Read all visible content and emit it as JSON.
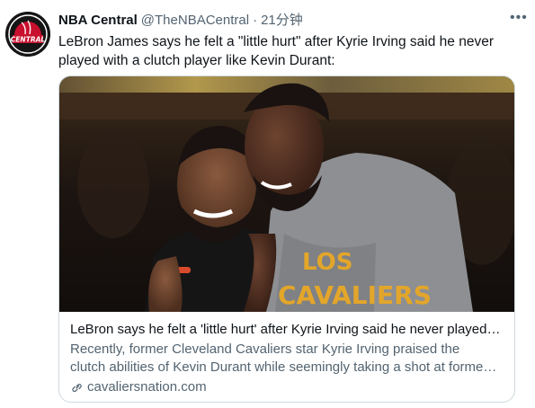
{
  "author": {
    "display_name": "NBA Central",
    "handle": "@TheNBACentral",
    "separator": "·",
    "time": "21分钟",
    "avatar_icon": "nba-central-logo",
    "avatar_text": "CENTRAL"
  },
  "more_icon": "ellipsis-icon",
  "tweet": {
    "text": "LeBron James says he felt a \"little hurt\" after Kyrie Irving said he never played with a clutch player like Kevin Durant:"
  },
  "card": {
    "image_desc": "photo",
    "image_text": [
      "LOS",
      "CAVALIERS"
    ],
    "title": "LeBron says he felt a 'little hurt' after Kyrie Irving said he never played…",
    "description_line1": "Recently, former Cleveland Cavaliers star Kyrie Irving praised the",
    "description_line2": "clutch abilities of Kevin Durant while seemingly taking a shot at forme…",
    "domain": "cavaliersnation.com",
    "link_icon": "link-icon"
  },
  "colors": {
    "text": "#0f1419",
    "secondary": "#536471",
    "border": "#cfd9de",
    "logo_red": "#c8102e"
  }
}
